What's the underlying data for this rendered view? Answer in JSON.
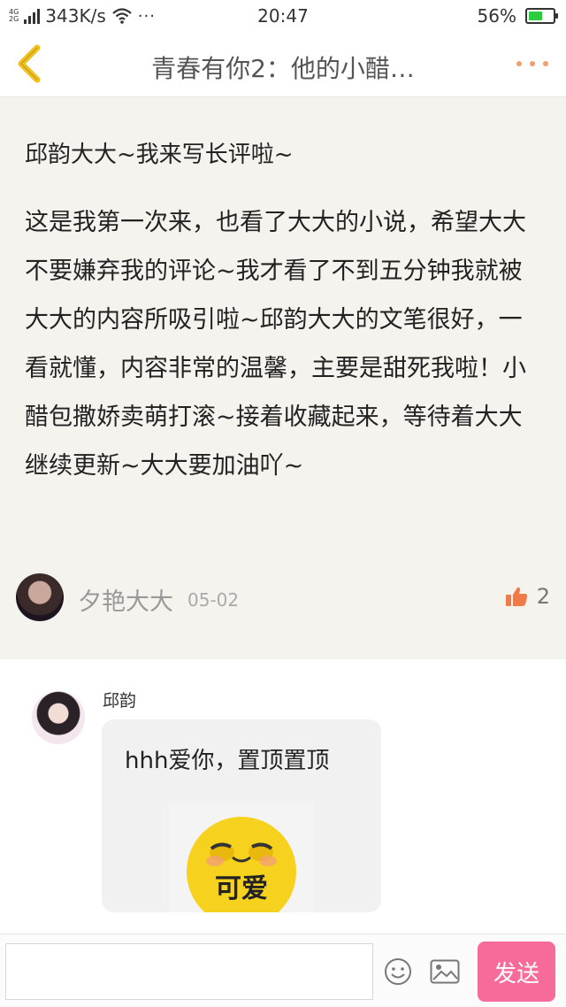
{
  "status_bar": {
    "network_type_top": "4G",
    "network_type_bottom": "2G",
    "speed": "343K/s",
    "time": "20:47",
    "battery_level": "56%",
    "battery_fraction": 0.56,
    "battery_color": "#2ecc40"
  },
  "nav": {
    "title": "青春有你2：他的小醋…",
    "back_icon": "chevron-left-icon",
    "more_icon": "more-dots-icon",
    "accent_color": "#f0c020"
  },
  "comment": {
    "heading": "邱韵大大~我来写长评啦~",
    "body": "这是我第一次来，也看了大大的小说，希望大大不要嫌弃我的评论~我才看了不到五分钟我就被大大的内容所吸引啦~邱韵大大的文笔很好，一看就懂，内容非常的温馨，主要是甜死我啦！小醋包撒娇卖萌打滚~接着收藏起来，等待着大大继续更新~大大要加油吖~",
    "author": "夕艳大大",
    "date": "05-02",
    "like_count": "2",
    "like_color": "#f07a4a"
  },
  "reply": {
    "author": "邱韵",
    "text": "hhh爱你，置顶置顶",
    "sticker_label": "可爱"
  },
  "input_bar": {
    "placeholder": "",
    "send_label": "发送",
    "send_color": "#f66b9a"
  }
}
